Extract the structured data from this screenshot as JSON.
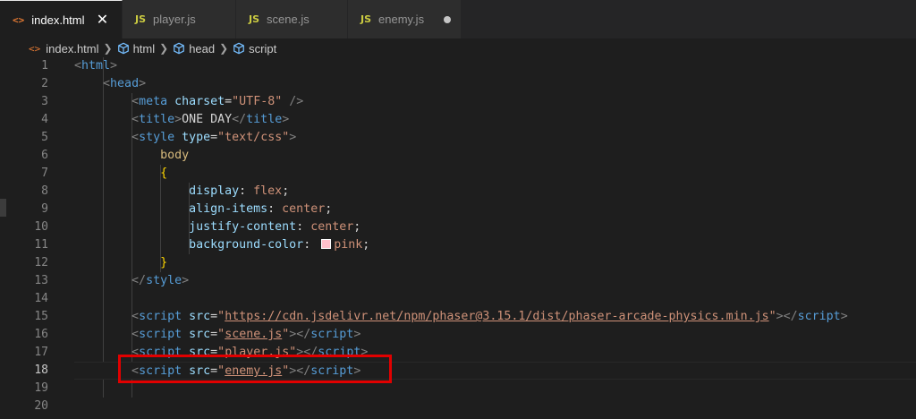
{
  "tabs": [
    {
      "icon": "<>",
      "label": "index.html",
      "active": true,
      "close": "✕"
    },
    {
      "icon": "JS",
      "label": "player.js"
    },
    {
      "icon": "JS",
      "label": "scene.js"
    },
    {
      "icon": "JS",
      "label": "enemy.js",
      "dirty": true
    }
  ],
  "breadcrumb": {
    "file_icon": "<>",
    "file": "index.html",
    "items": [
      "html",
      "head",
      "script"
    ]
  },
  "line_numbers": [
    "1",
    "2",
    "3",
    "4",
    "5",
    "6",
    "7",
    "8",
    "9",
    "10",
    "11",
    "12",
    "13",
    "14",
    "15",
    "16",
    "17",
    "18",
    "19",
    "20"
  ],
  "current_line": "18",
  "code": {
    "l1": {
      "open": "<",
      "tag": "html",
      "close": ">"
    },
    "l2": {
      "open": "<",
      "tag": "head",
      "close": ">"
    },
    "l3": {
      "open": "<",
      "tag": "meta",
      "attr": "charset",
      "eq": "=",
      "val": "\"UTF-8\"",
      "close": " />"
    },
    "l4": {
      "open": "<",
      "tag": "title",
      "close": ">",
      "text": "ONE DAY",
      "endopen": "</",
      "endtag": "title",
      "endclose": ">"
    },
    "l5": {
      "open": "<",
      "tag": "style",
      "attr": "type",
      "eq": "=",
      "val": "\"text/css\"",
      "close": ">"
    },
    "l6": {
      "selector": "body"
    },
    "l7": {
      "brace": "{"
    },
    "l8": {
      "prop": "display",
      "colon": ": ",
      "value": "flex",
      "semi": ";"
    },
    "l9": {
      "prop": "align-items",
      "colon": ": ",
      "value": "center",
      "semi": ";"
    },
    "l10": {
      "prop": "justify-content",
      "colon": ": ",
      "value": "center",
      "semi": ";"
    },
    "l11": {
      "prop": "background-color",
      "colon": ": ",
      "value": "pink",
      "semi": ";",
      "swatch_color": "#ffc0cb"
    },
    "l12": {
      "brace": "}"
    },
    "l13": {
      "endopen": "</",
      "endtag": "style",
      "endclose": ">"
    },
    "l15": {
      "open": "<",
      "tag": "script",
      "attr": "src",
      "eq": "=",
      "q1": "\"",
      "url": "https://cdn.jsdelivr.net/npm/phaser@3.15.1/dist/phaser-arcade-physics.min.js",
      "q2": "\"",
      "close": ">",
      "endopen": "</",
      "endtag": "script",
      "endclose": ">"
    },
    "l16": {
      "open": "<",
      "tag": "script",
      "attr": "src",
      "eq": "=",
      "q1": "\"",
      "url": "scene.js",
      "q2": "\"",
      "close": ">",
      "endopen": "</",
      "endtag": "script",
      "endclose": ">"
    },
    "l17": {
      "open": "<",
      "tag": "script",
      "attr": "src",
      "eq": "=",
      "q1": "\"",
      "url": "player.js",
      "q2": "\"",
      "close": ">",
      "endopen": "</",
      "endtag": "script",
      "endclose": ">"
    },
    "l18": {
      "open": "<",
      "tag": "script",
      "attr": "src",
      "eq": "=",
      "q1": "\"",
      "url": "enemy.js",
      "q2": "\"",
      "close": ">",
      "endopen": "</",
      "endtag": "script",
      "endclose": ">"
    }
  },
  "colors": {
    "highlight_box": "#e10000",
    "editor_bg": "#1e1e1e",
    "tab_bar_bg": "#252526"
  }
}
